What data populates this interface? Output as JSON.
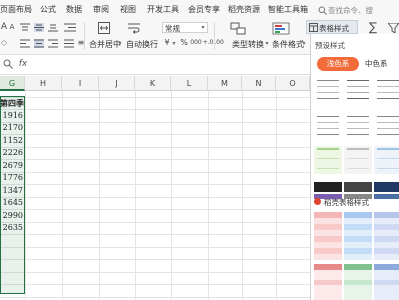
{
  "menu": {
    "items": [
      "页面布局",
      "公式",
      "数据",
      "审阅",
      "视图",
      "开发工具",
      "会员专享",
      "稻壳资源",
      "智能工具箱"
    ],
    "table_style_button": "表格样式",
    "search_placeholder": "查找命令、搜"
  },
  "ribbon": {
    "merge_center": "合并居中",
    "wrap_text": "自动换行",
    "number_format": "常规",
    "type_convert": "类型转换",
    "conditional_format": "条件格式",
    "font_size_up": "A",
    "font_size_down": "A",
    "percent": "%",
    "thousands": "000",
    "dec_inc": "+.0",
    "dec_dec": ".00",
    "yen": "¥"
  },
  "grid": {
    "columns": [
      "G",
      "H",
      "I",
      "J",
      "K",
      "L",
      "M",
      "N",
      "O"
    ],
    "selected_column": "G",
    "header_cell": "第四季",
    "values": [
      "1916",
      "2170",
      "1152",
      "2226",
      "2679",
      "1776",
      "1347",
      "1645",
      "2990",
      "2635"
    ]
  },
  "panel": {
    "title": "预设样式",
    "tab_light": "浅色系",
    "tab_medium": "中色系",
    "daoke_label": "稻壳表格样式"
  },
  "colors": {
    "accent": "#217346",
    "orange_tab": "#f26b3a"
  }
}
